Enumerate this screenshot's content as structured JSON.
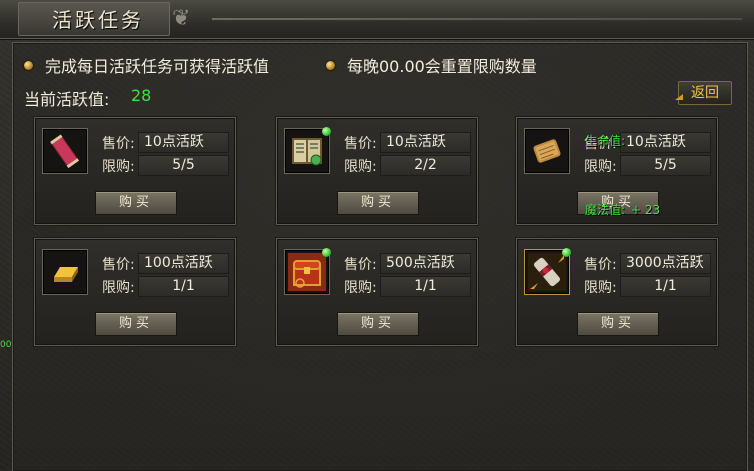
{
  "window": {
    "title": "活跃任务"
  },
  "notices": [
    {
      "text": "完成每日活跃任务可获得活跃值"
    },
    {
      "text": "每晚00.00会重置限购数量"
    }
  ],
  "activity": {
    "label": "当前活跃值:",
    "value": "28"
  },
  "back_button": {
    "label": "返回"
  },
  "shop": {
    "price_label": "售价:",
    "limit_label": "限购:",
    "buy_label": "购买",
    "items": [
      {
        "icon": "red-scroll-icon",
        "price": "10点活跃",
        "limit": "5/5",
        "has_gem": false
      },
      {
        "icon": "open-book-icon",
        "price": "10点活跃",
        "limit": "2/2",
        "has_gem": true
      },
      {
        "icon": "parchment-icon",
        "price": "10点活跃",
        "limit": "5/5",
        "has_gem": false
      },
      {
        "icon": "gold-bar-icon",
        "price": "100点活跃",
        "limit": "1/1",
        "has_gem": false
      },
      {
        "icon": "treasure-chest-icon",
        "price": "500点活跃",
        "limit": "1/1",
        "has_gem": true
      },
      {
        "icon": "sealed-scroll-icon",
        "price": "3000点活跃",
        "limit": "1/1",
        "has_gem": true
      }
    ]
  },
  "overlay": {
    "hp_label": "生命值:",
    "mp_label": "魔法值:",
    "mp_value": "+ 23",
    "edge_text": "00"
  },
  "colors": {
    "accent_green": "#3ee23e",
    "back_gold": "#f3c64a"
  }
}
